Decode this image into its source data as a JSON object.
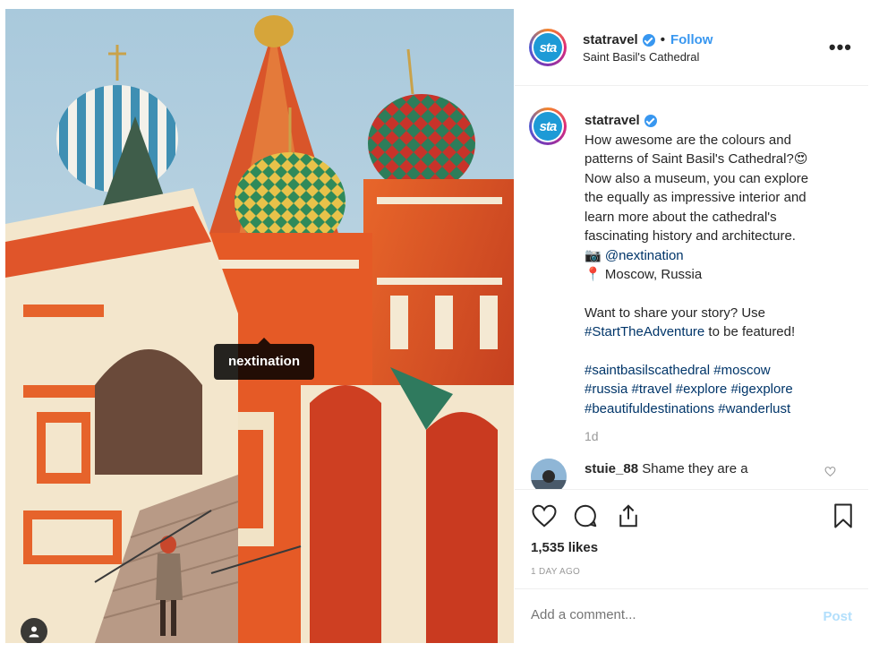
{
  "photo": {
    "tag_label": "nextination"
  },
  "header": {
    "avatar_text": "sta",
    "username": "statravel",
    "separator": "•",
    "follow_label": "Follow",
    "location": "Saint Basil's Cathedral",
    "more_label": "•••"
  },
  "caption": {
    "username": "statravel",
    "line1": "How awesome are the colours and",
    "line2": "patterns of Saint Basil's Cathedral?",
    "emoji1": "😍",
    "line3": "Now also a museum, you can explore",
    "line4": "the equally as impressive interior and",
    "line5": "learn more about the cathedral's",
    "line6": "fascinating history and architecture.",
    "camera_emoji": "📷",
    "photo_credit": "@nextination",
    "pin_emoji": "📍",
    "place": "Moscow, Russia",
    "cta_before": "Want to share your story? Use",
    "cta_hashtag": "#StartTheAdventure",
    "cta_after": "to be featured!",
    "hashtags": [
      "#saintbasilscathedral",
      "#moscow",
      "#russia",
      "#travel",
      "#explore",
      "#igexplore",
      "#beautifuldestinations",
      "#wanderlust"
    ],
    "age": "1d"
  },
  "reply": {
    "username": "stuie_88",
    "text": "Shame they are a"
  },
  "actions": {
    "likes": "1,535 likes",
    "timestamp": "1 DAY AGO"
  },
  "add_comment": {
    "placeholder": "Add a comment...",
    "post_label": "Post"
  },
  "colors": {
    "link": "#003569",
    "follow": "#3897f0",
    "post_disabled": "#b2dffc",
    "brand_logo": "#1d9ad6"
  }
}
